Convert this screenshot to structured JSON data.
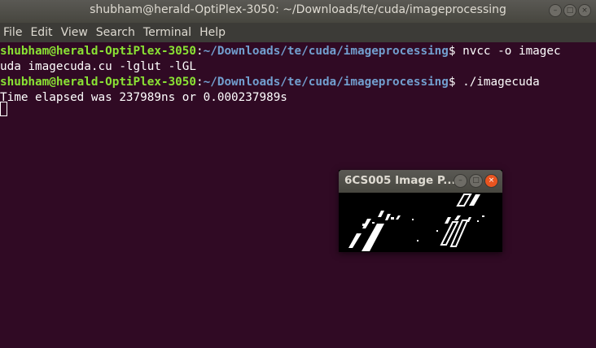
{
  "window": {
    "title": "shubham@herald-OptiPlex-3050: ~/Downloads/te/cuda/imageprocessing",
    "buttons": {
      "minimize": "–",
      "maximize": "□",
      "close": "×"
    }
  },
  "menu": [
    "File",
    "Edit",
    "View",
    "Search",
    "Terminal",
    "Help"
  ],
  "terminal": {
    "prompt_user": "shubham@herald-OptiPlex-3050",
    "prompt_sep": ":",
    "prompt_path": "~/Downloads/te/cuda/imageprocessing",
    "prompt_end": "$ ",
    "cmd1_part1": "nvcc -o imagec",
    "cmd1_part2": "uda imagecuda.cu -lglut -lGL",
    "cmd2": "./imagecuda",
    "output": "Time elapsed was 237989ns or 0.000237989s"
  },
  "popup": {
    "title": "6CS005 Image P...",
    "buttons": {
      "minimize": "–",
      "maximize": "□",
      "close": "×"
    }
  }
}
